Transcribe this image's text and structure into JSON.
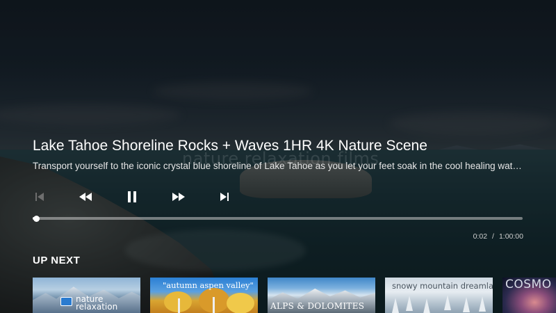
{
  "video": {
    "title": "Lake Tahoe Shoreline Rocks + Waves 1HR 4K Nature Scene",
    "description": "Transport yourself to the iconic crystal blue shoreline of Lake Tahoe as you let your feet soak in the cool healing water…",
    "watermark": "nature relaxation films"
  },
  "controls": {
    "skip_previous_icon": "skip-previous-icon",
    "rewind_icon": "rewind-icon",
    "pause_icon": "pause-icon",
    "fast_forward_icon": "fast-forward-icon",
    "skip_next_icon": "skip-next-icon",
    "skip_previous_disabled": true
  },
  "playback": {
    "current_time": "0:02",
    "separator": "/",
    "duration": "1:00:00",
    "progress_fraction": 0.0006
  },
  "up_next": {
    "heading": "UP NEXT",
    "items": [
      {
        "line1": "nature",
        "line2": "relaxation"
      },
      {
        "label": "\"autumn aspen valley\""
      },
      {
        "label": "ALPS & DOLOMITES"
      },
      {
        "label": "snowy mountain dreamland"
      },
      {
        "label": "COSMO"
      }
    ]
  },
  "colors": {
    "progress_track": "#c8c8c8",
    "progress_fill": "#ffffff",
    "text_primary": "#ffffff"
  }
}
